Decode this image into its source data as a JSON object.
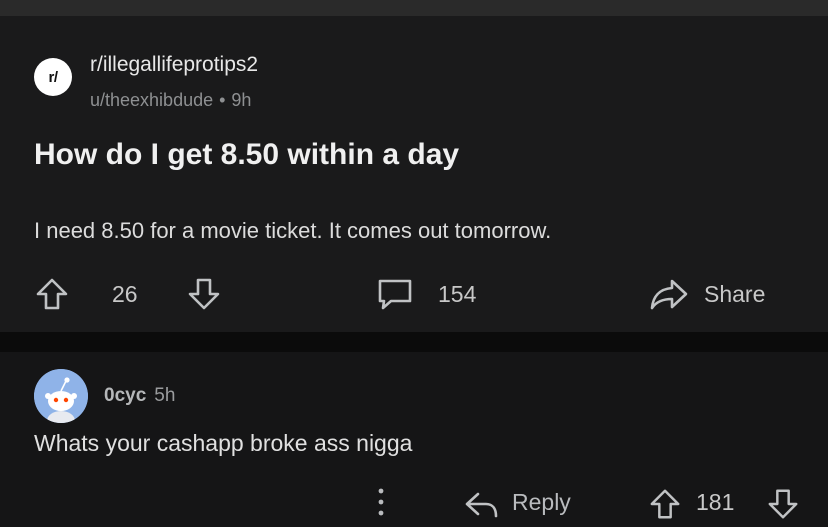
{
  "post": {
    "subreddit_icon_text": "r/",
    "subreddit": "r/illegallifeprotips2",
    "author": "u/theexhibdude",
    "separator": "•",
    "age": "9h",
    "title": "How do I get 8.50 within a day",
    "body": "I need 8.50 for a movie ticket.  It comes out tomorrow.",
    "score": "26",
    "comment_count": "154",
    "share_label": "Share"
  },
  "comment": {
    "username": "0cyc",
    "age": "5h",
    "text": "Whats your cashapp broke ass nigga",
    "reply_label": "Reply",
    "score": "181",
    "avatar_color": "#8fb3e8"
  }
}
